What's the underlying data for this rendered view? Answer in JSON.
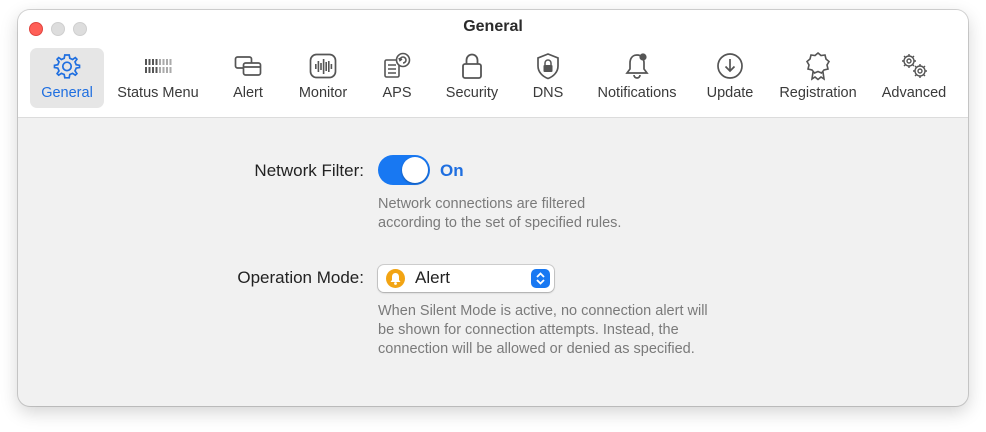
{
  "window": {
    "title": "General"
  },
  "toolbar": {
    "tabs": [
      {
        "label": "General",
        "icon": "gear-icon",
        "selected": true
      },
      {
        "label": "Status Menu",
        "icon": "status-menu-icon",
        "selected": false
      },
      {
        "label": "Alert",
        "icon": "alert-window-icon",
        "selected": false
      },
      {
        "label": "Monitor",
        "icon": "monitor-waveform-icon",
        "selected": false
      },
      {
        "label": "APS",
        "icon": "aps-refresh-icon",
        "selected": false
      },
      {
        "label": "Security",
        "icon": "lock-icon",
        "selected": false
      },
      {
        "label": "DNS",
        "icon": "shield-lock-icon",
        "selected": false
      },
      {
        "label": "Notifications",
        "icon": "bell-badge-icon",
        "selected": false
      },
      {
        "label": "Update",
        "icon": "download-circle-icon",
        "selected": false
      },
      {
        "label": "Registration",
        "icon": "award-ribbon-icon",
        "selected": false
      },
      {
        "label": "Advanced",
        "icon": "gears-icon",
        "selected": false
      }
    ]
  },
  "settings": {
    "network_filter": {
      "label": "Network Filter:",
      "state": "On",
      "description_line1": "Network connections are filtered",
      "description_line2": "according to the set of specified rules."
    },
    "operation_mode": {
      "label": "Operation Mode:",
      "selected": "Alert",
      "description_line1": "When Silent Mode is active, no connection alert will",
      "description_line2": "be shown for connection attempts. Instead, the",
      "description_line3": "connection will be allowed or denied as specified."
    }
  },
  "colors": {
    "accent": "#1878f2",
    "selected_text": "#1f6fe0",
    "alert_icon": "#f2a413",
    "close": "#ff5f57"
  }
}
